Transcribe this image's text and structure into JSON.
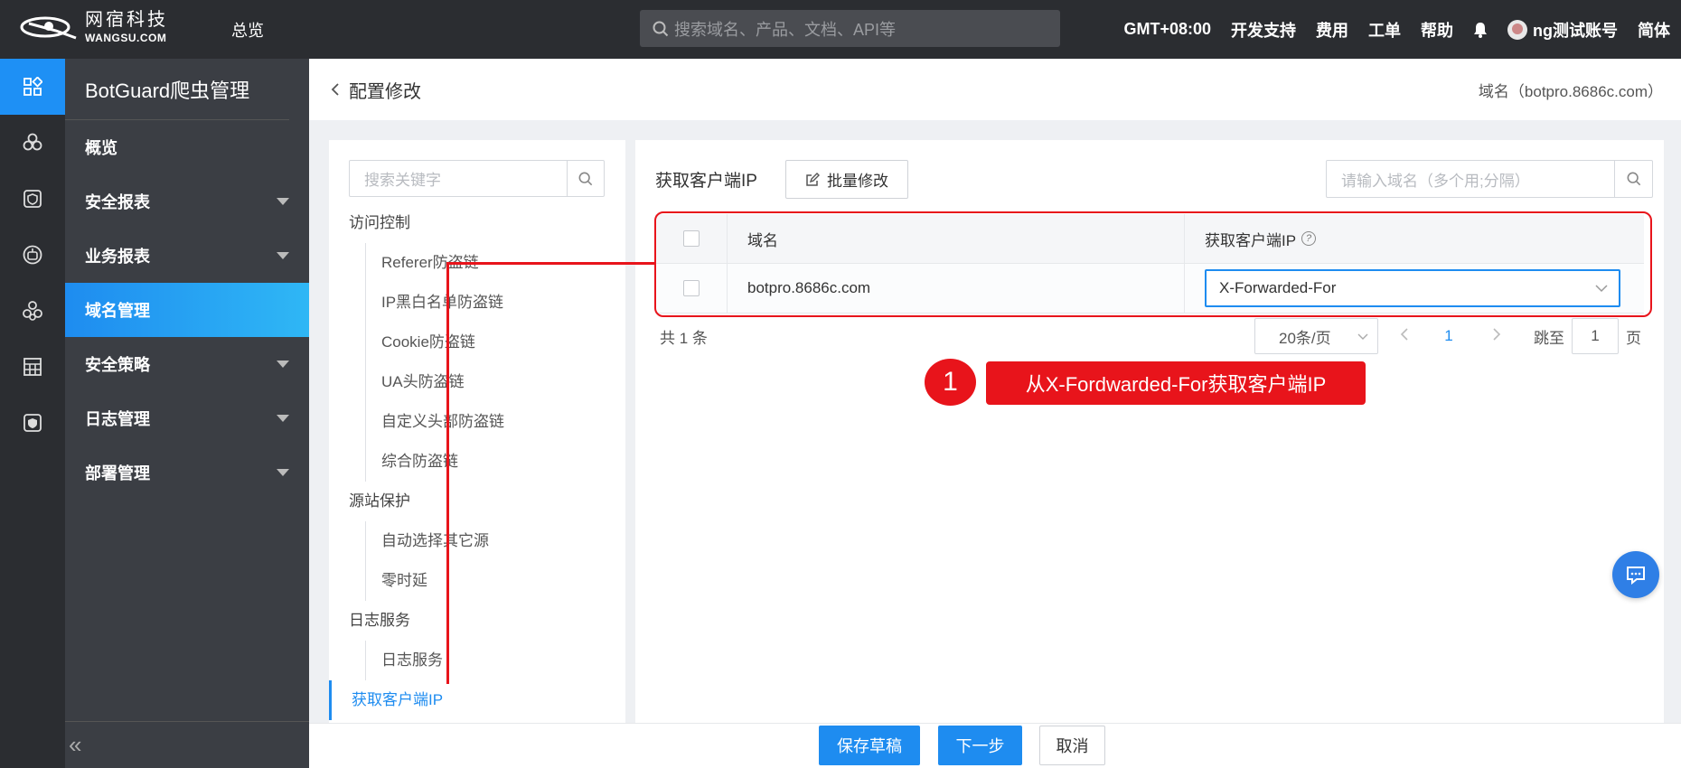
{
  "topbar": {
    "logo_cn": "网宿科技",
    "logo_en": "WANGSU.COM",
    "overview": "总览",
    "search_placeholder": "搜索域名、产品、文档、API等",
    "timezone": "GMT+08:00",
    "dev_support": "开发支持",
    "billing": "费用",
    "ticket": "工单",
    "help": "帮助",
    "account": "ng测试账号",
    "language": "简体"
  },
  "sidebar": {
    "title": "BotGuard爬虫管理",
    "items": [
      {
        "label": "概览",
        "expandable": false,
        "active": false
      },
      {
        "label": "安全报表",
        "expandable": true,
        "active": false
      },
      {
        "label": "业务报表",
        "expandable": true,
        "active": false
      },
      {
        "label": "域名管理",
        "expandable": false,
        "active": true
      },
      {
        "label": "安全策略",
        "expandable": true,
        "active": false
      },
      {
        "label": "日志管理",
        "expandable": true,
        "active": false
      },
      {
        "label": "部署管理",
        "expandable": true,
        "active": false
      }
    ],
    "collapse": "«"
  },
  "page": {
    "back_title": "配置修改",
    "domain_label": "域名（botpro.8686c.com）"
  },
  "left_panel": {
    "search_placeholder": "搜索关键字",
    "tree": {
      "g1": "访问控制",
      "g1_items": [
        "Referer防盗链",
        "IP黑白名单防盗链",
        "Cookie防盗链",
        "UA头防盗链",
        "自定义头部防盗链",
        "综合防盗链"
      ],
      "g2": "源站保护",
      "g2_items": [
        "自动选择其它源",
        "零时延"
      ],
      "g3": "日志服务",
      "g3_items": [
        "日志服务"
      ],
      "current": "获取客户端IP"
    }
  },
  "main": {
    "title": "获取客户端IP",
    "batch_edit": "批量修改",
    "search_placeholder": "请输入域名（多个用;分隔）",
    "table": {
      "col_domain": "域名",
      "col_client_ip": "获取客户端IP",
      "rows": [
        {
          "domain": "botpro.8686c.com",
          "client_ip": "X-Forwarded-For"
        }
      ]
    },
    "total": "共 1 条",
    "pager": {
      "page_size": "20条/页",
      "current": "1",
      "jump_label": "跳至",
      "jump_value": "1",
      "page_unit": "页"
    }
  },
  "callout": {
    "number": "1",
    "text": "从X-Fordwarded-For获取客户端IP"
  },
  "footer": {
    "save_draft": "保存草稿",
    "next": "下一步",
    "cancel": "取消"
  },
  "colors": {
    "accent": "#1e8cf0",
    "annotation": "#e8141b",
    "topbar": "#2b2d31",
    "sidebar": "#3b3e44"
  }
}
